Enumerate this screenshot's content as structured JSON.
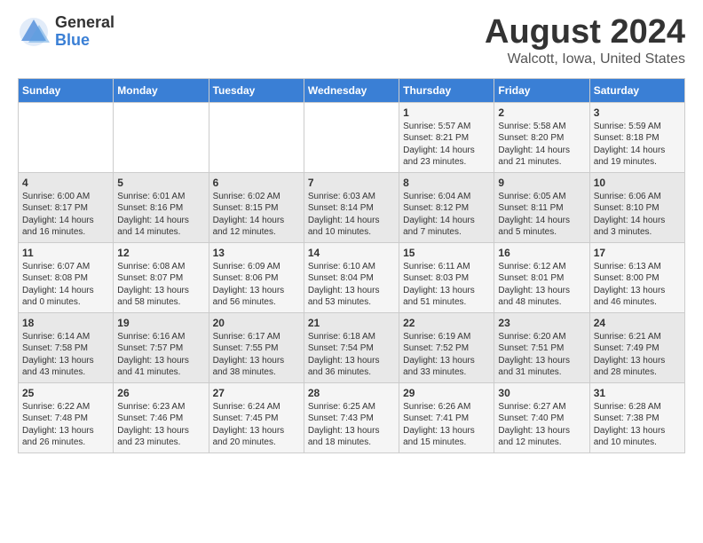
{
  "logo": {
    "general": "General",
    "blue": "Blue"
  },
  "title": "August 2024",
  "subtitle": "Walcott, Iowa, United States",
  "days_of_week": [
    "Sunday",
    "Monday",
    "Tuesday",
    "Wednesday",
    "Thursday",
    "Friday",
    "Saturday"
  ],
  "weeks": [
    [
      {
        "day": "",
        "content": ""
      },
      {
        "day": "",
        "content": ""
      },
      {
        "day": "",
        "content": ""
      },
      {
        "day": "",
        "content": ""
      },
      {
        "day": "1",
        "content": "Sunrise: 5:57 AM\nSunset: 8:21 PM\nDaylight: 14 hours and 23 minutes."
      },
      {
        "day": "2",
        "content": "Sunrise: 5:58 AM\nSunset: 8:20 PM\nDaylight: 14 hours and 21 minutes."
      },
      {
        "day": "3",
        "content": "Sunrise: 5:59 AM\nSunset: 8:18 PM\nDaylight: 14 hours and 19 minutes."
      }
    ],
    [
      {
        "day": "4",
        "content": "Sunrise: 6:00 AM\nSunset: 8:17 PM\nDaylight: 14 hours and 16 minutes."
      },
      {
        "day": "5",
        "content": "Sunrise: 6:01 AM\nSunset: 8:16 PM\nDaylight: 14 hours and 14 minutes."
      },
      {
        "day": "6",
        "content": "Sunrise: 6:02 AM\nSunset: 8:15 PM\nDaylight: 14 hours and 12 minutes."
      },
      {
        "day": "7",
        "content": "Sunrise: 6:03 AM\nSunset: 8:14 PM\nDaylight: 14 hours and 10 minutes."
      },
      {
        "day": "8",
        "content": "Sunrise: 6:04 AM\nSunset: 8:12 PM\nDaylight: 14 hours and 7 minutes."
      },
      {
        "day": "9",
        "content": "Sunrise: 6:05 AM\nSunset: 8:11 PM\nDaylight: 14 hours and 5 minutes."
      },
      {
        "day": "10",
        "content": "Sunrise: 6:06 AM\nSunset: 8:10 PM\nDaylight: 14 hours and 3 minutes."
      }
    ],
    [
      {
        "day": "11",
        "content": "Sunrise: 6:07 AM\nSunset: 8:08 PM\nDaylight: 14 hours and 0 minutes."
      },
      {
        "day": "12",
        "content": "Sunrise: 6:08 AM\nSunset: 8:07 PM\nDaylight: 13 hours and 58 minutes."
      },
      {
        "day": "13",
        "content": "Sunrise: 6:09 AM\nSunset: 8:06 PM\nDaylight: 13 hours and 56 minutes."
      },
      {
        "day": "14",
        "content": "Sunrise: 6:10 AM\nSunset: 8:04 PM\nDaylight: 13 hours and 53 minutes."
      },
      {
        "day": "15",
        "content": "Sunrise: 6:11 AM\nSunset: 8:03 PM\nDaylight: 13 hours and 51 minutes."
      },
      {
        "day": "16",
        "content": "Sunrise: 6:12 AM\nSunset: 8:01 PM\nDaylight: 13 hours and 48 minutes."
      },
      {
        "day": "17",
        "content": "Sunrise: 6:13 AM\nSunset: 8:00 PM\nDaylight: 13 hours and 46 minutes."
      }
    ],
    [
      {
        "day": "18",
        "content": "Sunrise: 6:14 AM\nSunset: 7:58 PM\nDaylight: 13 hours and 43 minutes."
      },
      {
        "day": "19",
        "content": "Sunrise: 6:16 AM\nSunset: 7:57 PM\nDaylight: 13 hours and 41 minutes."
      },
      {
        "day": "20",
        "content": "Sunrise: 6:17 AM\nSunset: 7:55 PM\nDaylight: 13 hours and 38 minutes."
      },
      {
        "day": "21",
        "content": "Sunrise: 6:18 AM\nSunset: 7:54 PM\nDaylight: 13 hours and 36 minutes."
      },
      {
        "day": "22",
        "content": "Sunrise: 6:19 AM\nSunset: 7:52 PM\nDaylight: 13 hours and 33 minutes."
      },
      {
        "day": "23",
        "content": "Sunrise: 6:20 AM\nSunset: 7:51 PM\nDaylight: 13 hours and 31 minutes."
      },
      {
        "day": "24",
        "content": "Sunrise: 6:21 AM\nSunset: 7:49 PM\nDaylight: 13 hours and 28 minutes."
      }
    ],
    [
      {
        "day": "25",
        "content": "Sunrise: 6:22 AM\nSunset: 7:48 PM\nDaylight: 13 hours and 26 minutes."
      },
      {
        "day": "26",
        "content": "Sunrise: 6:23 AM\nSunset: 7:46 PM\nDaylight: 13 hours and 23 minutes."
      },
      {
        "day": "27",
        "content": "Sunrise: 6:24 AM\nSunset: 7:45 PM\nDaylight: 13 hours and 20 minutes."
      },
      {
        "day": "28",
        "content": "Sunrise: 6:25 AM\nSunset: 7:43 PM\nDaylight: 13 hours and 18 minutes."
      },
      {
        "day": "29",
        "content": "Sunrise: 6:26 AM\nSunset: 7:41 PM\nDaylight: 13 hours and 15 minutes."
      },
      {
        "day": "30",
        "content": "Sunrise: 6:27 AM\nSunset: 7:40 PM\nDaylight: 13 hours and 12 minutes."
      },
      {
        "day": "31",
        "content": "Sunrise: 6:28 AM\nSunset: 7:38 PM\nDaylight: 13 hours and 10 minutes."
      }
    ]
  ]
}
